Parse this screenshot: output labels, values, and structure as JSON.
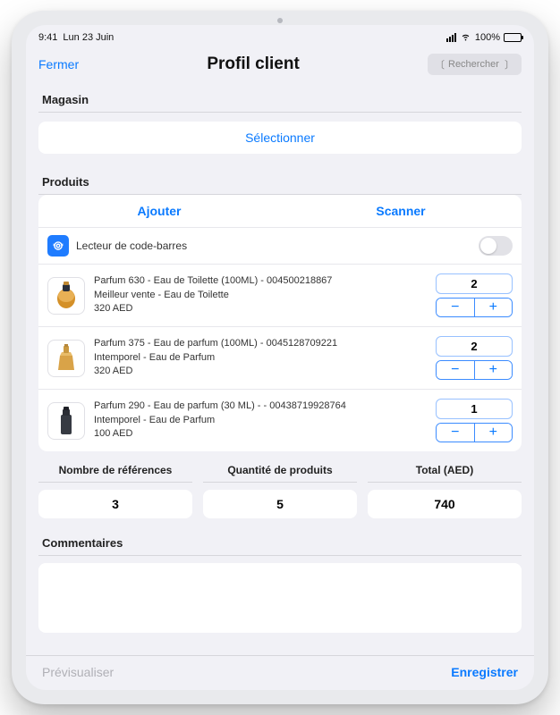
{
  "status": {
    "time": "9:41",
    "date": "Lun 23 Juin",
    "battery": "100%"
  },
  "nav": {
    "close": "Fermer",
    "title": "Profil client",
    "search_placeholder": "Rechercher"
  },
  "sections": {
    "magasin": "Magasin",
    "produits": "Produits",
    "commentaires": "Commentaires"
  },
  "magasin": {
    "select": "Sélectionner"
  },
  "tabs": {
    "ajouter": "Ajouter",
    "scanner": "Scanner"
  },
  "scanner": {
    "label": "Lecteur de code-barres"
  },
  "products": [
    {
      "title": "Parfum 630 - Eau de Toilette (100ML) - 004500218867",
      "sub": "Meilleur vente  - Eau de Toilette",
      "price": "320 AED",
      "qty": "2"
    },
    {
      "title": "Parfum 375 - Eau de parfum (100ML) - 0045128709221",
      "sub": "Intemporel - Eau de Parfum",
      "price": "320 AED",
      "qty": "2"
    },
    {
      "title": "Parfum 290 - Eau de parfum (30 ML) - - 00438719928764",
      "sub": "Intemporel  - Eau de Parfum",
      "price": "100 AED",
      "qty": "1"
    }
  ],
  "summary": {
    "refs_label": "Nombre de références",
    "refs_value": "3",
    "qty_label": "Quantité de produits",
    "qty_value": "5",
    "total_label": "Total (AED)",
    "total_value": "740"
  },
  "bottom": {
    "preview": "Prévisualiser",
    "save": "Enregistrer"
  }
}
